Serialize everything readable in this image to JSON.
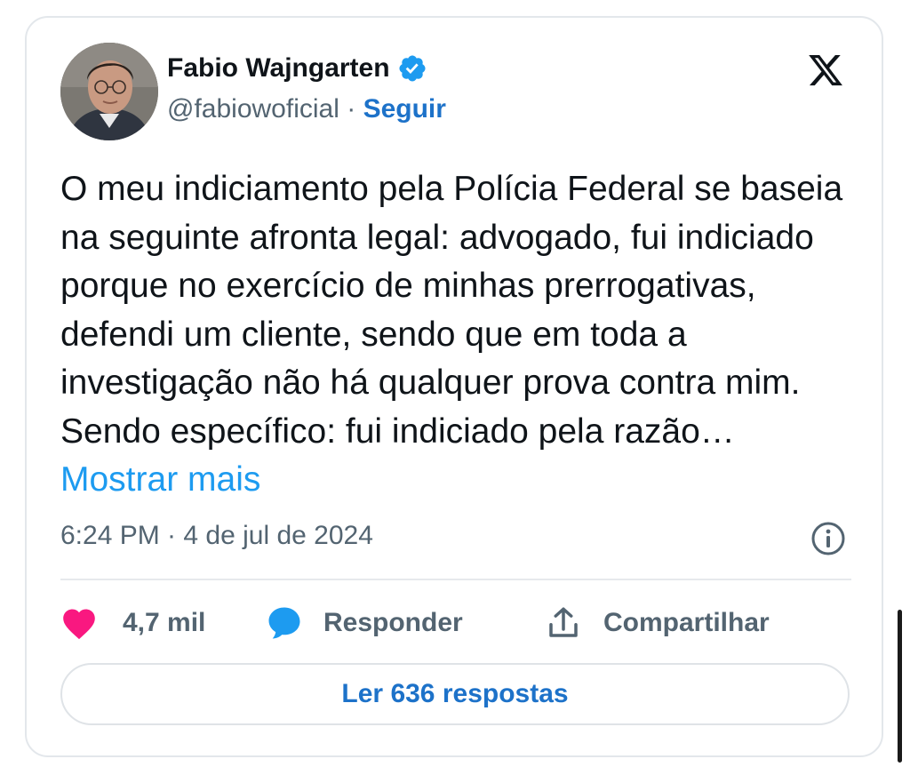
{
  "author": {
    "name": "Fabio Wajngarten",
    "handle": "@fabiowoficial",
    "separator": "·",
    "follow_label": "Seguir",
    "verified": true
  },
  "tweet": {
    "text": "O meu indiciamento pela Polícia Federal se baseia na seguinte afronta legal: advogado, fui indiciado porque no exercício de minhas prerrogativas, defendi um cliente, sendo que em toda a investigação não há qualquer prova contra mim. Sendo específico: fui indiciado pela razão…",
    "show_more_label": "Mostrar mais",
    "timestamp": "6:24 PM · 4 de jul de 2024"
  },
  "actions": {
    "likes": "4,7 mil",
    "reply_label": "Responder",
    "share_label": "Compartilhar"
  },
  "read_replies_label": "Ler 636 respostas",
  "icons": [
    "verified-badge-icon",
    "x-logo-icon",
    "info-icon",
    "heart-icon",
    "reply-bubble-icon",
    "share-icon"
  ],
  "colors": {
    "text": "#0f1419",
    "secondary": "#536471",
    "link": "#1d9bf0",
    "follow": "#1d72c9",
    "like": "#f91880",
    "reply_icon": "#1d9bf0",
    "border": "#e3e7eb"
  }
}
